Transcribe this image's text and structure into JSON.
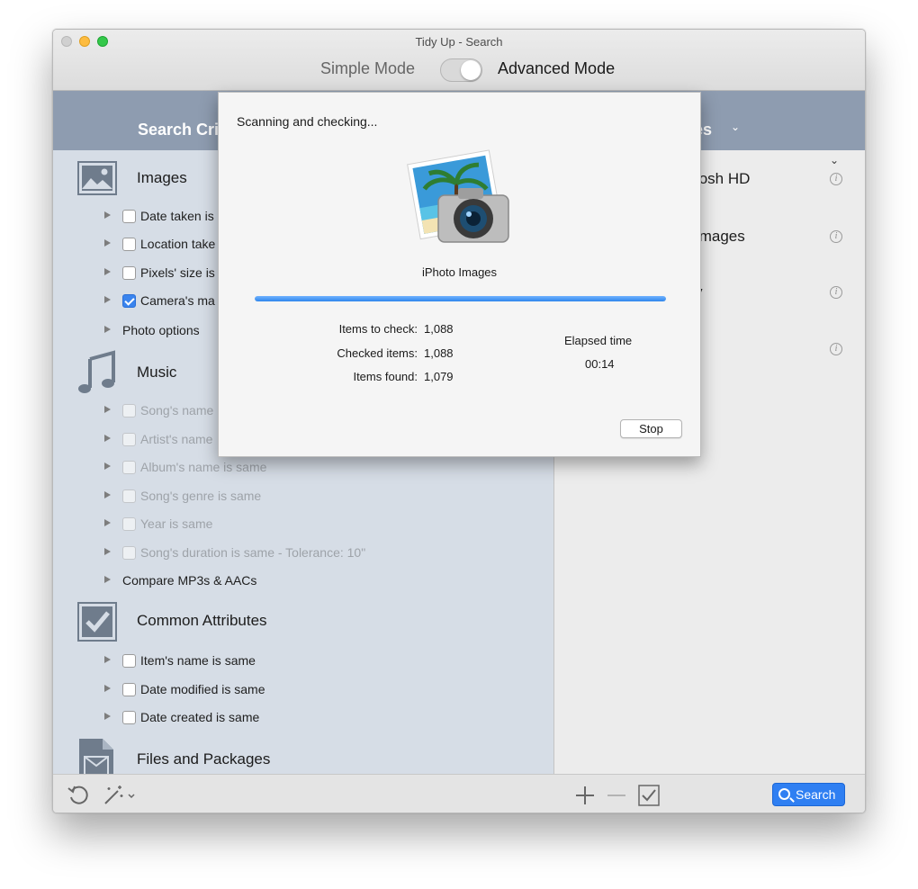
{
  "window": {
    "title": "Tidy Up - Search",
    "mode_simple": "Simple Mode",
    "mode_advanced": "Advanced Mode",
    "advanced_mode_on": true
  },
  "header": {
    "left_label": "Search Cri",
    "right_label": "es",
    "right_chevron": "chevron-down-icon"
  },
  "left": {
    "sections": [
      {
        "title": "Images",
        "icon": "image-icon",
        "rows": [
          {
            "label": "Date taken is",
            "checked": false,
            "dim": false
          },
          {
            "label": "Location take",
            "checked": false,
            "dim": false
          },
          {
            "label": "Pixels' size is",
            "checked": false,
            "dim": false
          },
          {
            "label": "Camera's ma",
            "checked": true,
            "dim": false
          },
          {
            "label": "Photo options",
            "no_checkbox": true
          }
        ]
      },
      {
        "title": "Music",
        "icon": "music-note-icon",
        "rows": [
          {
            "label": "Song's name",
            "checked": false,
            "dim": true
          },
          {
            "label": "Artist's name",
            "checked": false,
            "dim": true
          },
          {
            "label": "Album's name is same",
            "checked": false,
            "dim": true
          },
          {
            "label": "Song's genre is same",
            "checked": false,
            "dim": true
          },
          {
            "label": "Year is same",
            "checked": false,
            "dim": true
          },
          {
            "label": "Song's duration is same - Tolerance: 10\"",
            "checked": false,
            "dim": true
          },
          {
            "label": "Compare MP3s & AACs",
            "no_checkbox": true
          }
        ]
      },
      {
        "title": "Common Attributes",
        "icon": "checkbox-icon",
        "rows": [
          {
            "label": "Item's name is same",
            "checked": false,
            "dim": false
          },
          {
            "label": "Date modified is same",
            "checked": false,
            "dim": false
          },
          {
            "label": "Date created is same",
            "checked": false,
            "dim": false
          }
        ]
      },
      {
        "title": "Files and Packages",
        "icon": "file-package-icon",
        "rows": []
      }
    ]
  },
  "right": {
    "items": [
      {
        "label": "tosh HD"
      },
      {
        "label": "Images"
      },
      {
        "label": "y"
      },
      {
        "label": ""
      }
    ]
  },
  "bottombar": {
    "undo_icon": "undo-icon",
    "magic_icon": "magic-wand-icon",
    "add_icon": "plus-icon",
    "remove_icon": "minus-icon",
    "check_icon": "checkbox-icon",
    "search_label": "Search"
  },
  "sheet": {
    "title": "Scanning and checking...",
    "source_name": "iPhoto Images",
    "progress": 1.0,
    "items_to_check_label": "Items to check:",
    "items_to_check_value": "1,088",
    "checked_items_label": "Checked items:",
    "checked_items_value": "1,088",
    "items_found_label": "Items found:",
    "items_found_value": "1,079",
    "elapsed_label": "Elapsed time",
    "elapsed_value": "00:14",
    "stop_label": "Stop"
  },
  "colors": {
    "accent": "#2f7ff2",
    "header_band": "#8e9cb0",
    "left_panel": "#d6dde6"
  }
}
